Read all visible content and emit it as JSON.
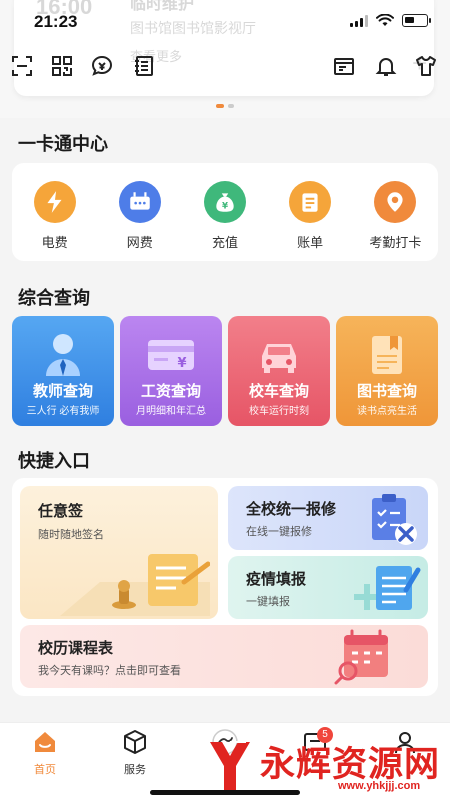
{
  "status_bar": {
    "time": "21:23"
  },
  "background_banner": {
    "time": "16:00",
    "title": "临时维护",
    "subtitle": "图书馆图书馆影视厅",
    "more": "查看更多"
  },
  "toolbar": {
    "left_icons": [
      "scan-icon",
      "qrcode-icon",
      "chat-bubble-icon",
      "notebook-icon"
    ],
    "right_icons": [
      "calendar-icon",
      "bell-icon",
      "tshirt-icon"
    ]
  },
  "banner_dots": {
    "count": 2,
    "active": 0
  },
  "card_center": {
    "title": "一卡通中心",
    "items": [
      {
        "label": "电费",
        "icon": "lightning-icon",
        "color": "#f5a53a"
      },
      {
        "label": "网费",
        "icon": "router-icon",
        "color": "#4e7de8"
      },
      {
        "label": "充值",
        "icon": "money-bag-icon",
        "color": "#3fb87b"
      },
      {
        "label": "账单",
        "icon": "bill-icon",
        "color": "#f5a53a"
      },
      {
        "label": "考勤打卡",
        "icon": "location-pin-icon",
        "color": "#f08a3c"
      }
    ]
  },
  "query": {
    "title": "综合查询",
    "items": [
      {
        "title": "教师查询",
        "subtitle": "三人行 必有我师",
        "icon": "teacher-icon",
        "color": "#3f8fe6"
      },
      {
        "title": "工资查询",
        "subtitle": "月明细和年汇总",
        "icon": "salary-card-icon",
        "color": "#a56be3"
      },
      {
        "title": "校车查询",
        "subtitle": "校车运行时刻",
        "icon": "bus-icon",
        "color": "#ee6a77"
      },
      {
        "title": "图书查询",
        "subtitle": "读书点亮生活",
        "icon": "book-icon",
        "color": "#f0a347"
      }
    ]
  },
  "quick": {
    "title": "快捷入口",
    "sign": {
      "title": "任意签",
      "subtitle": "随时随地签名"
    },
    "repair": {
      "title": "全校统一报修",
      "subtitle": "在线一键报修"
    },
    "epidemic": {
      "title": "疫情填报",
      "subtitle": "一键填报"
    },
    "schedule": {
      "title": "校历课程表",
      "subtitle": "我今天有课吗？点击即可查看"
    }
  },
  "bottom_nav": {
    "home": "首页",
    "service": "服务",
    "messages_badge": "5"
  },
  "watermark": {
    "text": "永辉资源网",
    "url": "www.yhkjjj.com"
  }
}
